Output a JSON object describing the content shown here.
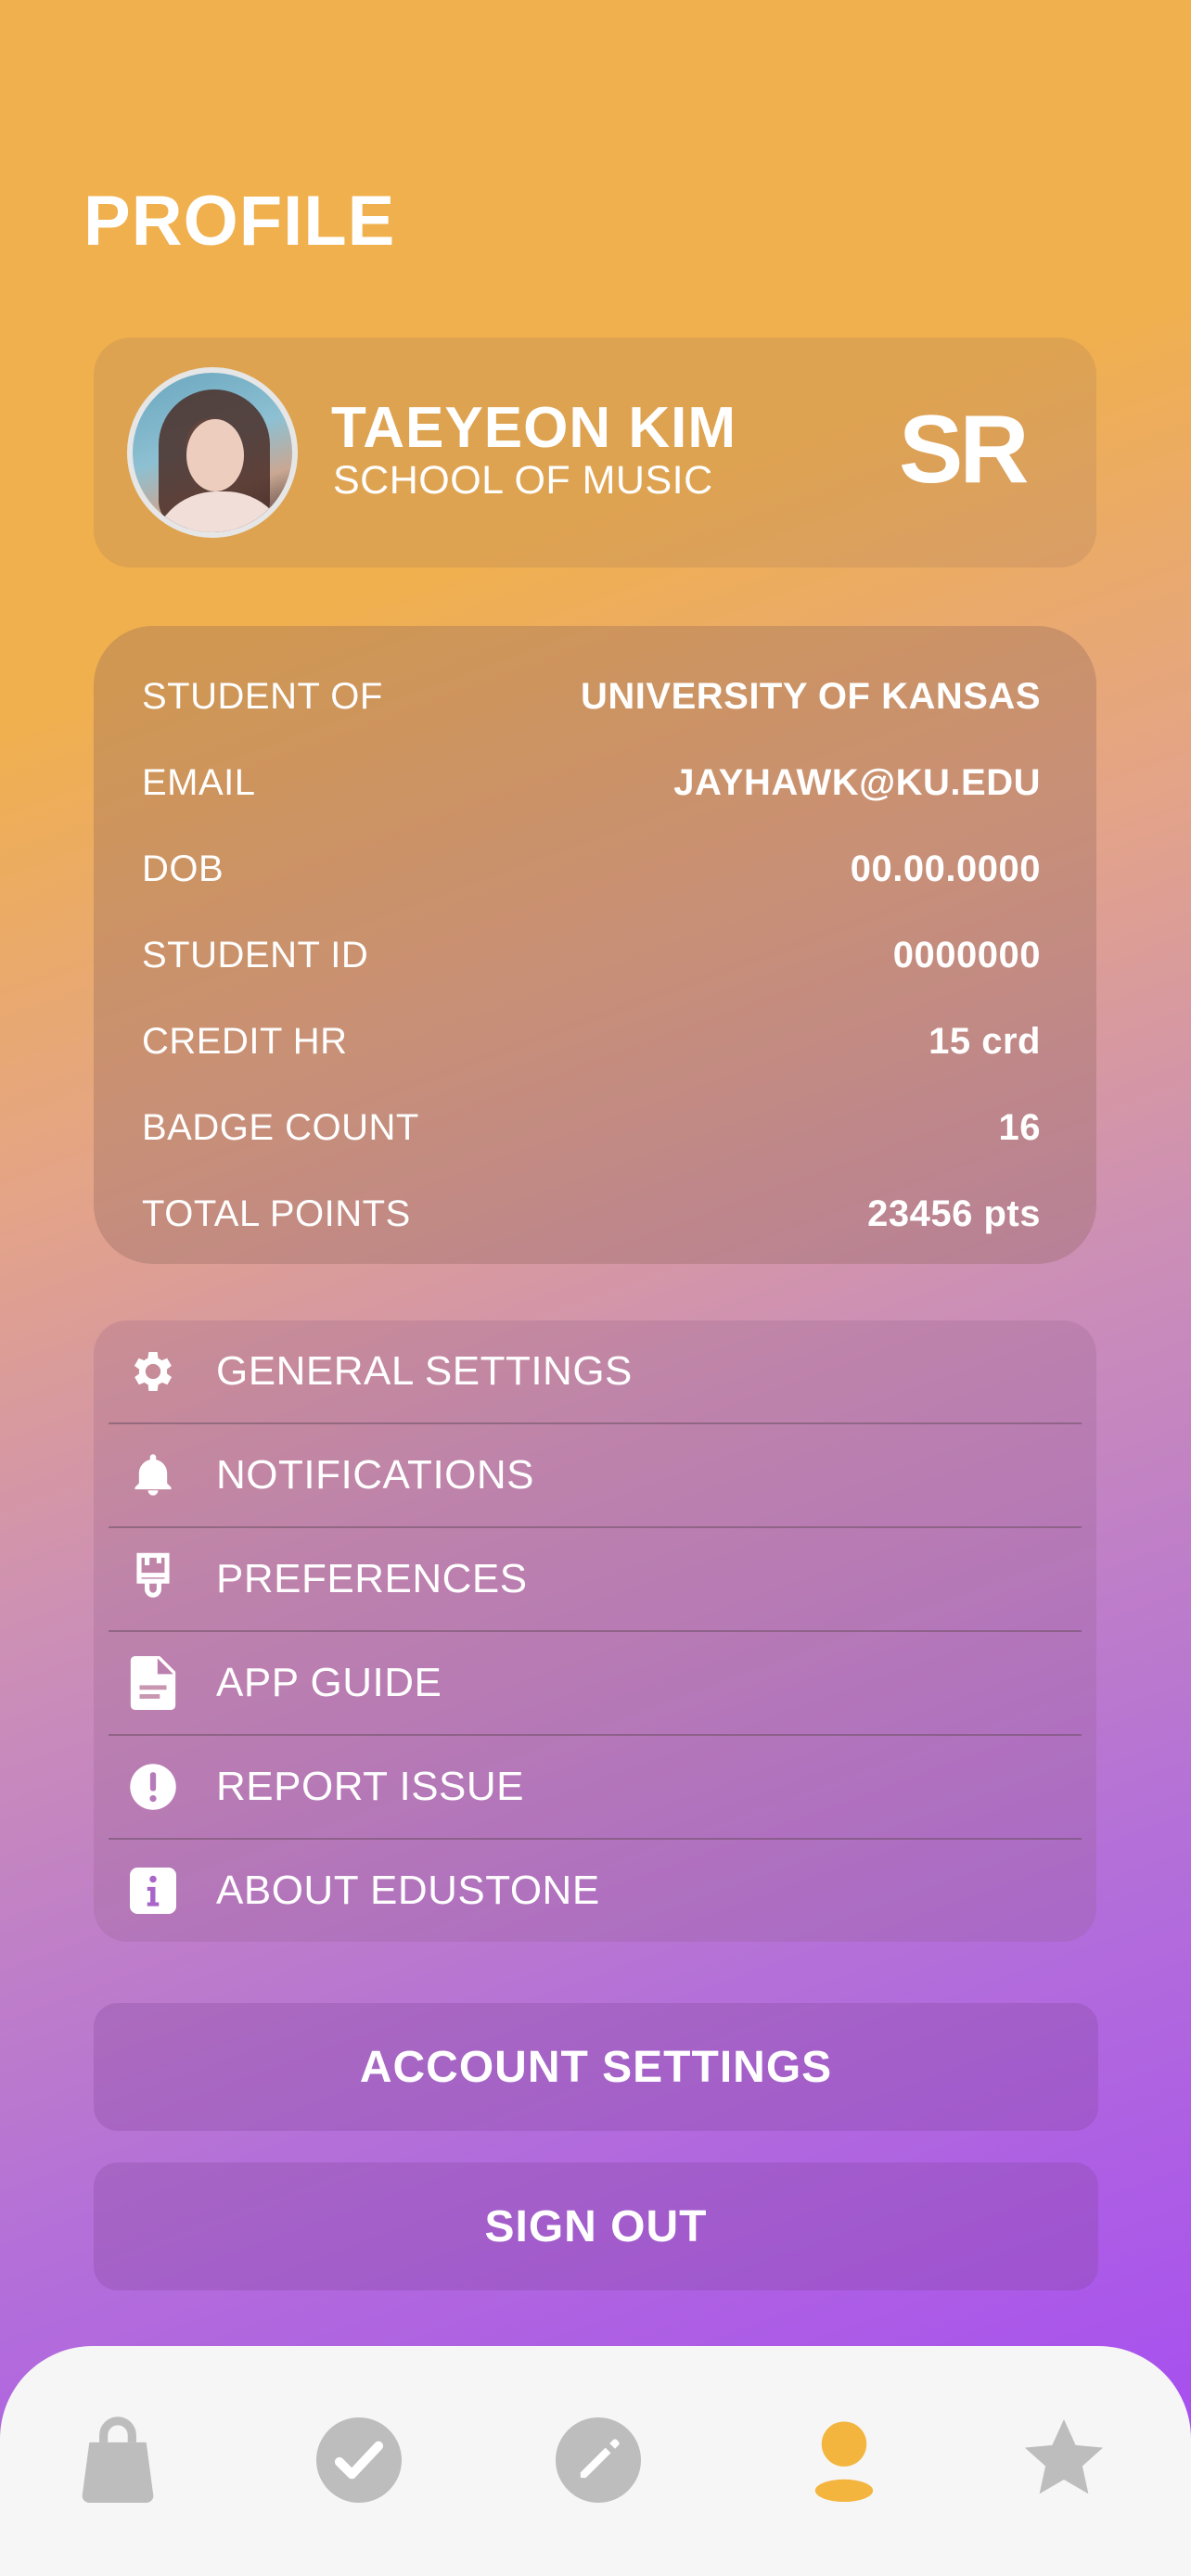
{
  "page": {
    "title": "PROFILE"
  },
  "profile": {
    "name": "TAEYEON KIM",
    "school": "SCHOOL OF MUSIC",
    "initials": "SR"
  },
  "info": [
    {
      "label": "STUDENT OF",
      "value": "UNIVERSITY OF KANSAS"
    },
    {
      "label": "EMAIL",
      "value": "JAYHAWK@KU.EDU"
    },
    {
      "label": "DOB",
      "value": "00.00.0000"
    },
    {
      "label": "STUDENT ID",
      "value": "0000000"
    },
    {
      "label": "CREDIT HR",
      "value": "15 crd"
    },
    {
      "label": "BADGE COUNT",
      "value": "16"
    },
    {
      "label": "TOTAL POINTS",
      "value": "23456 pts"
    }
  ],
  "menu": [
    {
      "label": "GENERAL SETTINGS",
      "icon": "gear-icon"
    },
    {
      "label": "NOTIFICATIONS",
      "icon": "bell-icon"
    },
    {
      "label": "PREFERENCES",
      "icon": "brush-icon"
    },
    {
      "label": "APP GUIDE",
      "icon": "document-icon"
    },
    {
      "label": "REPORT ISSUE",
      "icon": "alert-icon"
    },
    {
      "label": "ABOUT EDUSTONE",
      "icon": "info-icon"
    }
  ],
  "buttons": {
    "account_settings": "ACCOUNT SETTINGS",
    "sign_out": "SIGN OUT"
  },
  "tabbar": {
    "items": [
      {
        "icon": "shopping-bag-icon",
        "active": false
      },
      {
        "icon": "check-circle-icon",
        "active": false
      },
      {
        "icon": "edit-pencil-icon",
        "active": false
      },
      {
        "icon": "profile-person-icon",
        "active": true
      },
      {
        "icon": "star-icon",
        "active": false
      }
    ],
    "active_color": "#f4b53f",
    "inactive_color": "#bdbdbd"
  }
}
